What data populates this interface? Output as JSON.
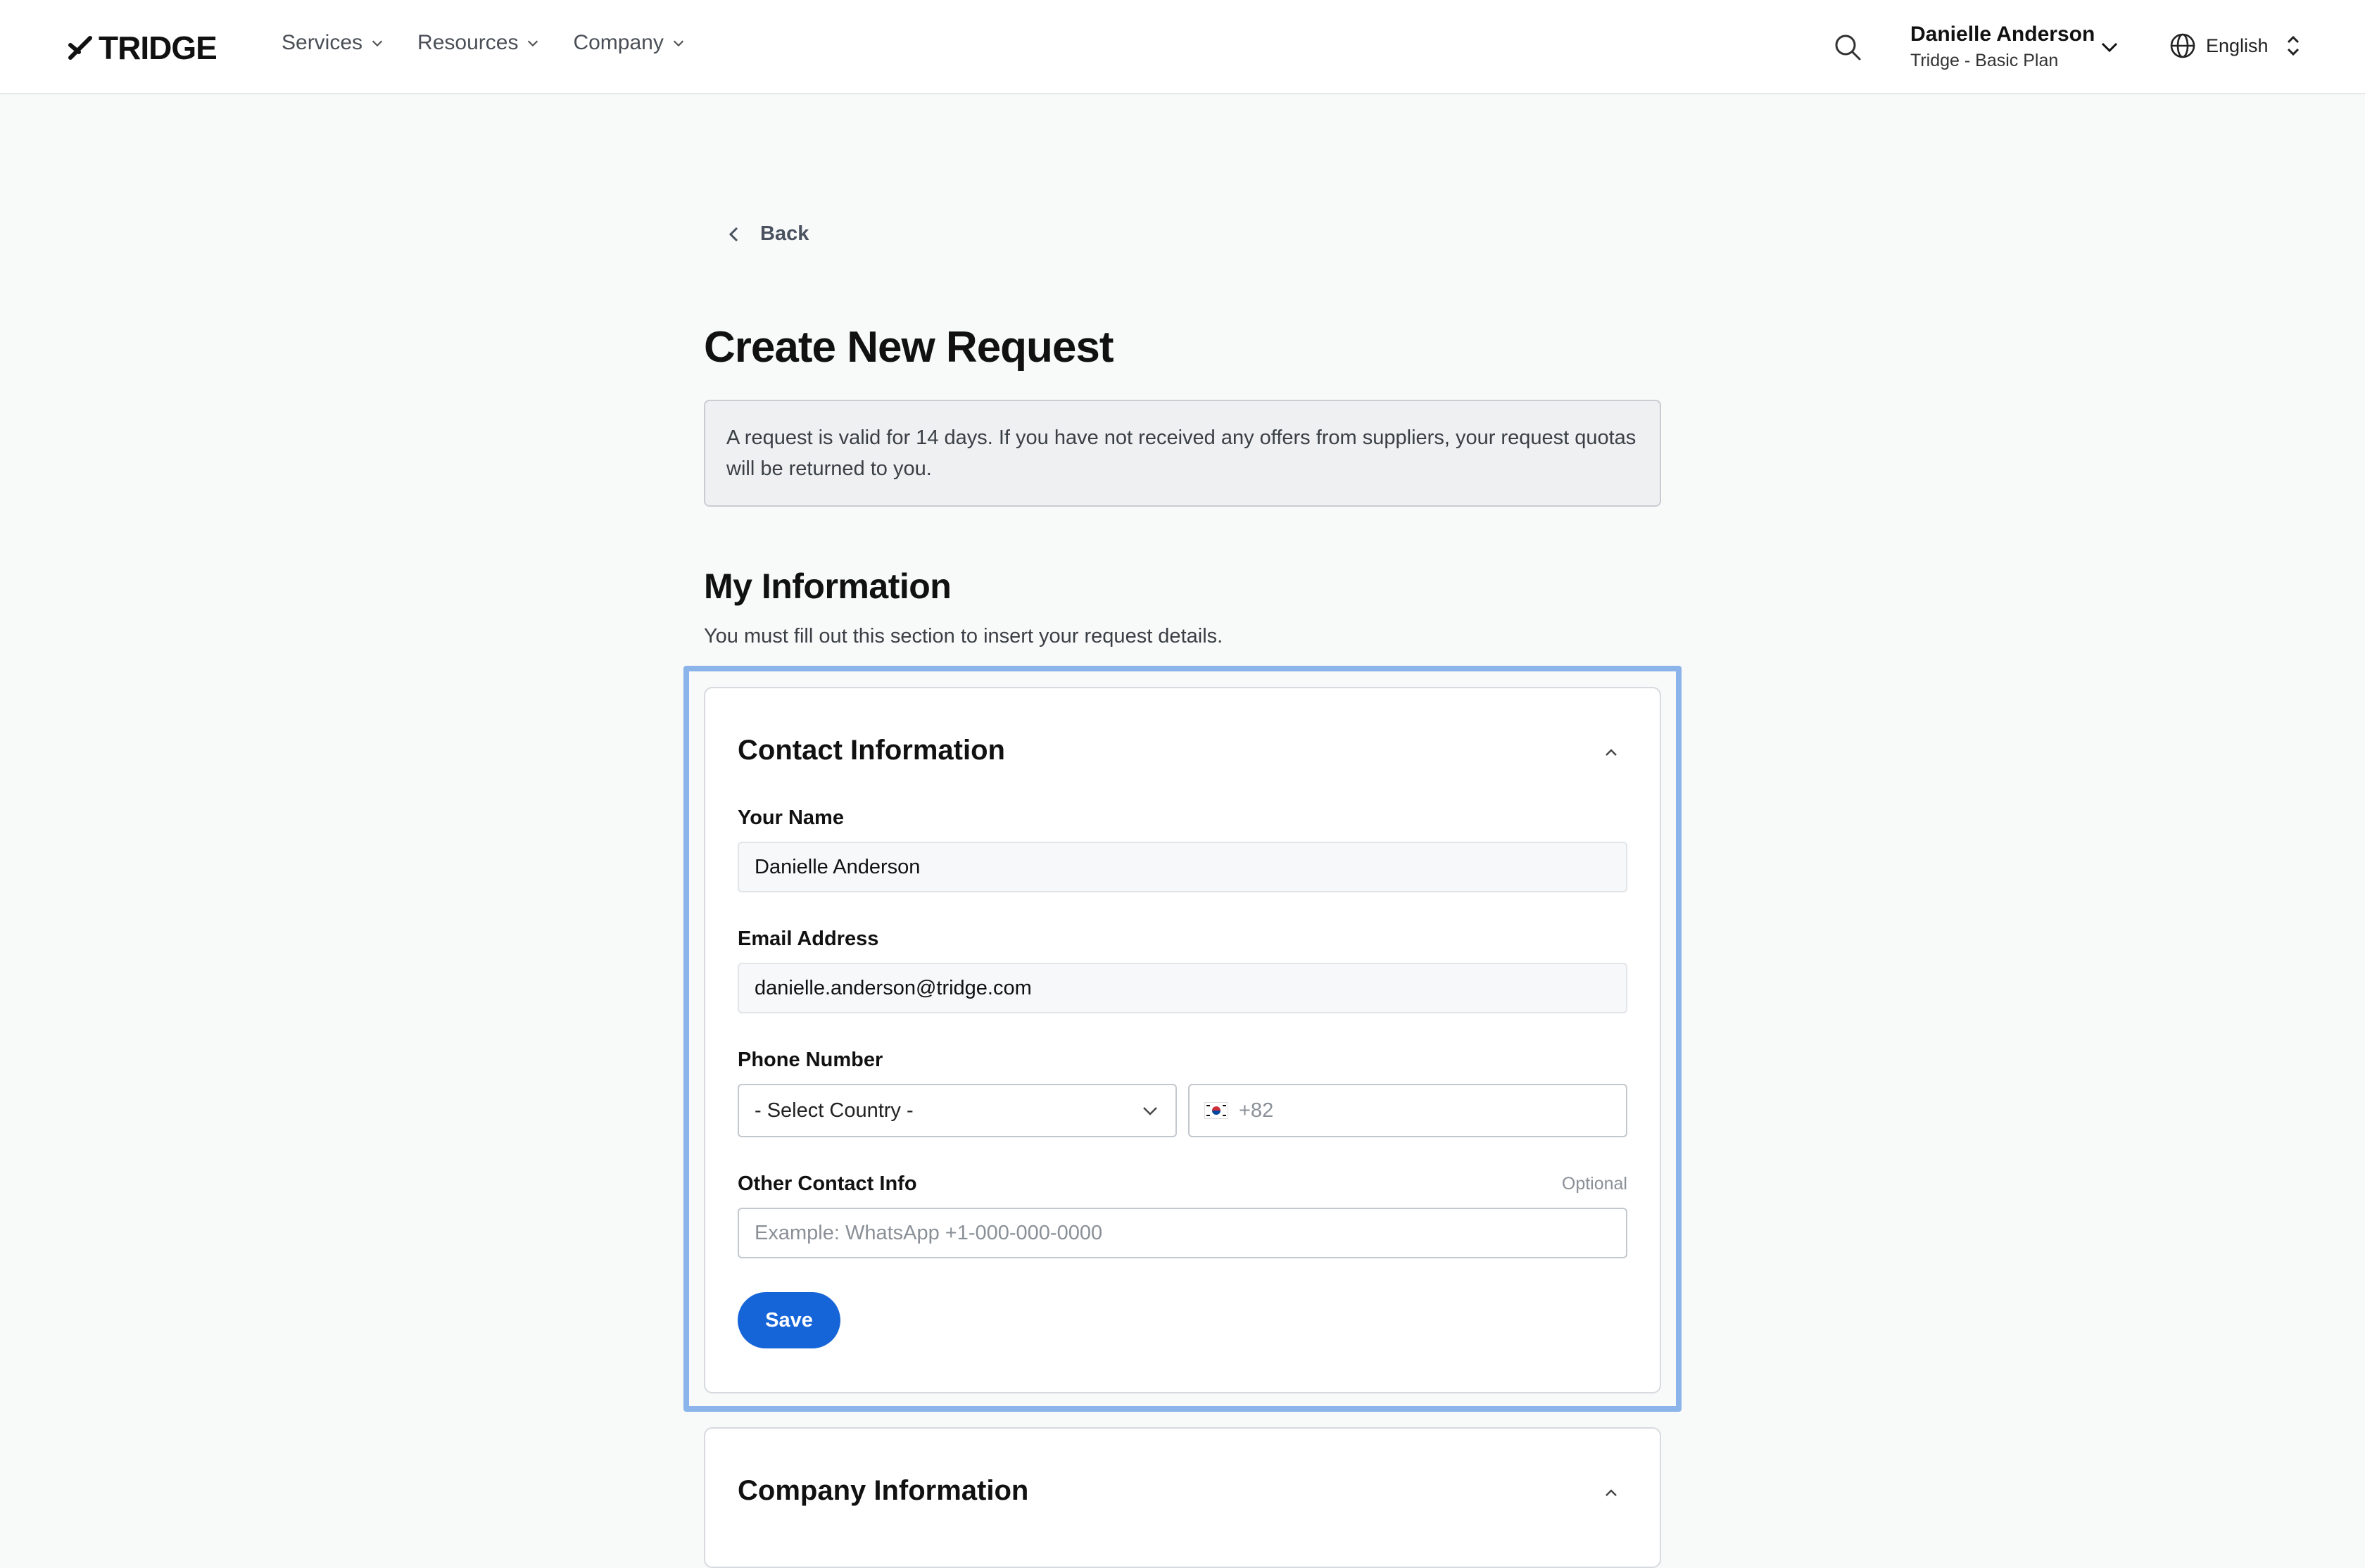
{
  "header": {
    "logo_text": "TRIDGE",
    "nav": [
      {
        "label": "Services"
      },
      {
        "label": "Resources"
      },
      {
        "label": "Company"
      }
    ],
    "user": {
      "name": "Danielle Anderson",
      "plan": "Tridge - Basic Plan"
    },
    "language": "English",
    "icons": {
      "search": "search-icon",
      "globe": "globe-icon"
    }
  },
  "page": {
    "back_label": "Back",
    "title": "Create New Request",
    "notice": "A request is valid for 14 days. If you have not received any offers from suppliers, your request quotas will be returned to you.",
    "section_title": "My Information",
    "section_subtitle": "You must fill out this section to insert your request details."
  },
  "contact_card": {
    "title": "Contact Information",
    "name_label": "Your Name",
    "name_value": "Danielle Anderson",
    "email_label": "Email Address",
    "email_value": "danielle.anderson@tridge.com",
    "phone_label": "Phone Number",
    "country_select": "- Select Country -",
    "phone_code_placeholder": "+82",
    "other_label": "Other Contact Info",
    "other_optional": "Optional",
    "other_placeholder": "Example: WhatsApp +1-000-000-0000",
    "save_label": "Save"
  },
  "company_card": {
    "title": "Company Information"
  },
  "colors": {
    "accent": "#1565d8",
    "highlight": "#8ab4ea",
    "page_bg": "#f8f9f9"
  }
}
